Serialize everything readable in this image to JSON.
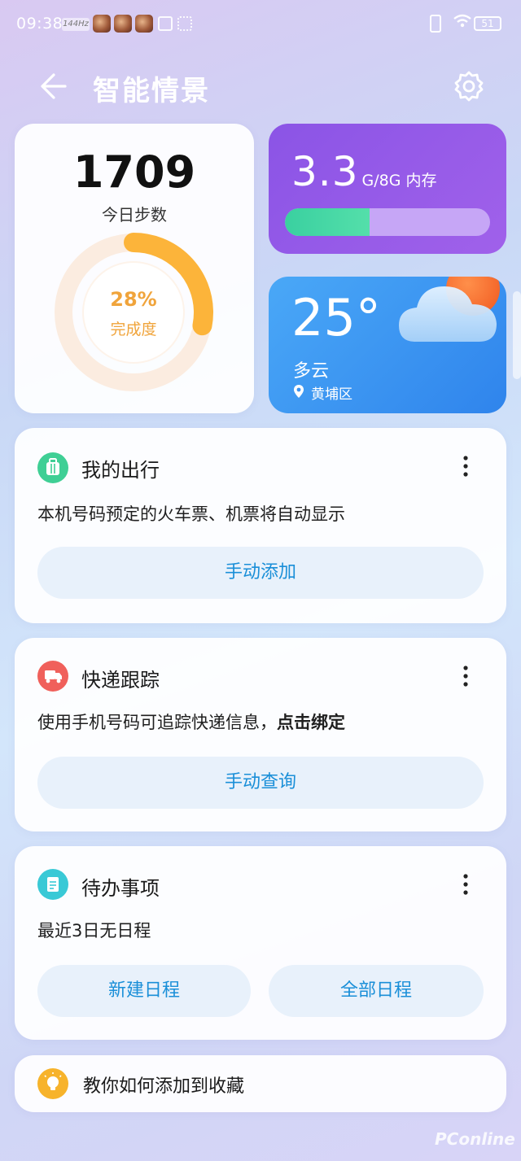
{
  "status": {
    "time": "09:38",
    "refresh": "144Hz",
    "battery": "51"
  },
  "header": {
    "title": "智能情景"
  },
  "steps": {
    "count": "1709",
    "label": "今日步数",
    "percent": "28%",
    "percent_label": "完成度",
    "progress": 0.28,
    "ring_color": "#fcb43a"
  },
  "memory": {
    "used": "3.3",
    "unit": "G/8G 内存",
    "used_fraction": 0.4125
  },
  "weather": {
    "temp": "25°",
    "condition": "多云",
    "location": "黄埔区"
  },
  "travel": {
    "title": "我的出行",
    "desc": "本机号码预定的火车票、机票将自动显示",
    "button": "手动添加",
    "icon": "luggage-icon"
  },
  "express": {
    "title": "快递跟踪",
    "desc": "使用手机号码可追踪快递信息，",
    "desc_link": "点击绑定",
    "button": "手动查询",
    "icon": "truck-icon"
  },
  "todo": {
    "title": "待办事项",
    "desc": "最近3日无日程",
    "button_new": "新建日程",
    "button_all": "全部日程",
    "icon": "note-icon"
  },
  "tips": {
    "text": "教你如何添加到收藏",
    "icon": "lightbulb-icon"
  },
  "watermark": "PConline",
  "colors": {
    "accent": "#1a8fd8",
    "memory_bg": "#9a5ce8",
    "weather_bg": "#3a92f0",
    "travel_icon": "#3fcf95",
    "express_icon": "#f0605b",
    "todo_icon": "#39c9d6",
    "tips_icon": "#f7b32b"
  }
}
